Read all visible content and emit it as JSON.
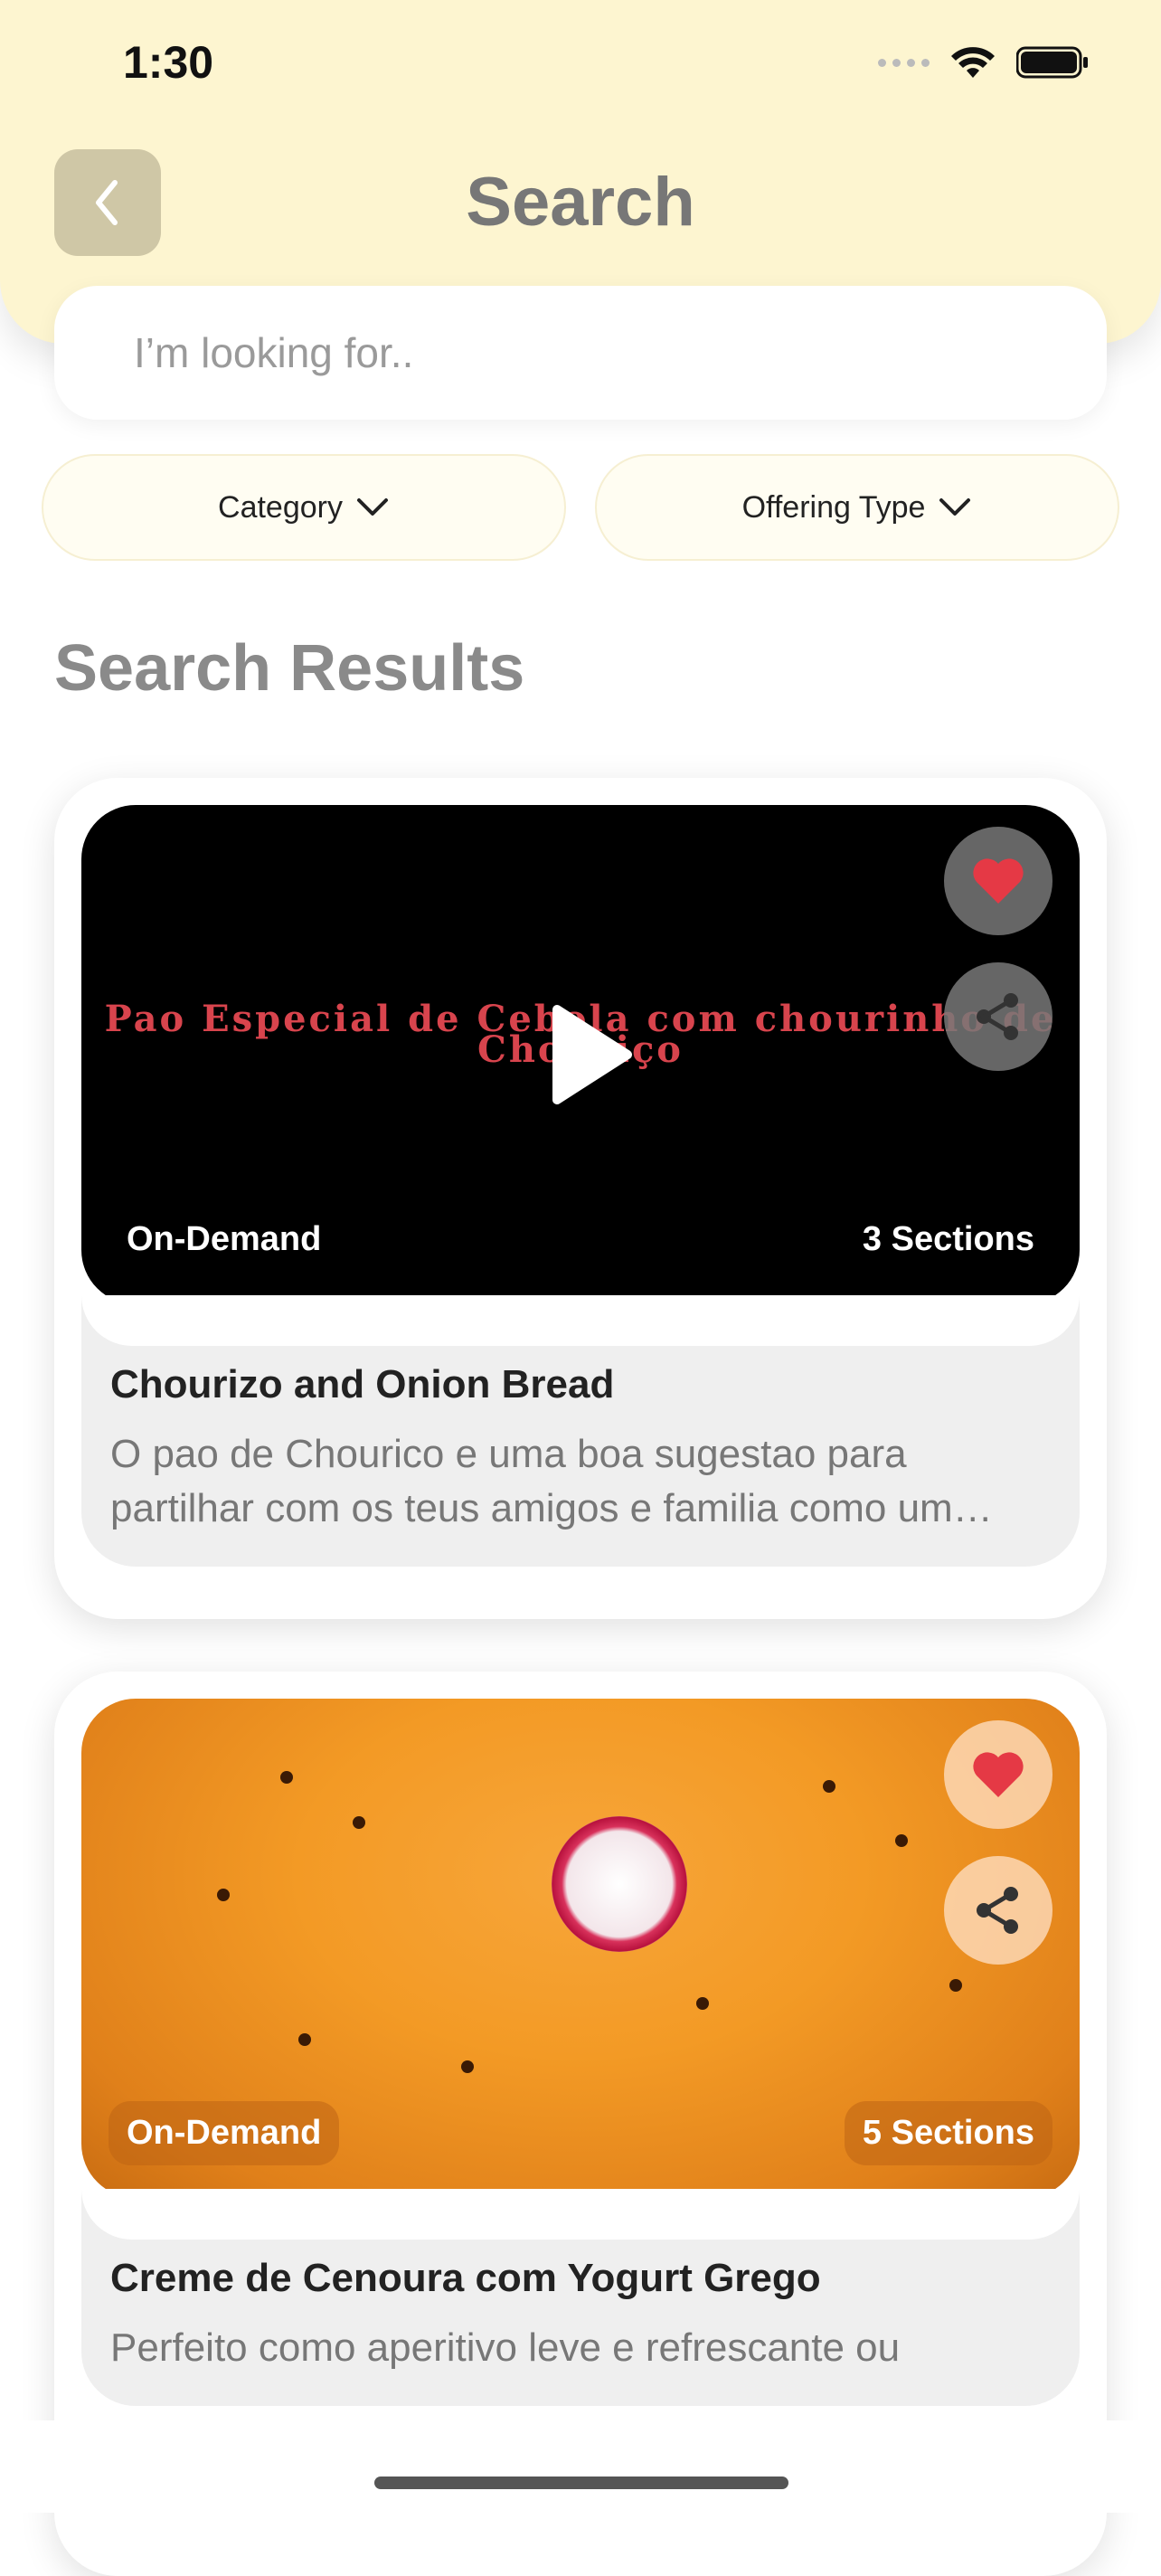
{
  "status_bar": {
    "time": "1:30"
  },
  "header": {
    "title": "Search",
    "back_icon": "chevron-left-icon"
  },
  "search": {
    "placeholder": "I’m looking for.."
  },
  "filters": [
    {
      "label": "Category",
      "icon": "chevron-down-icon"
    },
    {
      "label": "Offering Type",
      "icon": "chevron-down-icon"
    }
  ],
  "results": {
    "title": "Search Results",
    "items": [
      {
        "video_overlay_text": "Pao Especial de Cebola com chourinho de Chouriço",
        "type": "On-Demand",
        "sections": "3 Sections",
        "title": "Chourizo and Onion Bread",
        "description": "O pao de Chourico e uma boa sugestao para partilhar com os teus amigos e familia como um…"
      },
      {
        "type": "On-Demand",
        "sections": "5 Sections",
        "title": "Creme de Cenoura com Yogurt Grego",
        "description": "Perfeito como aperitivo leve e refrescante ou"
      }
    ]
  },
  "colors": {
    "header_bg": "#fdf5d0",
    "heart": "#e53945",
    "title_gray": "#777777"
  }
}
